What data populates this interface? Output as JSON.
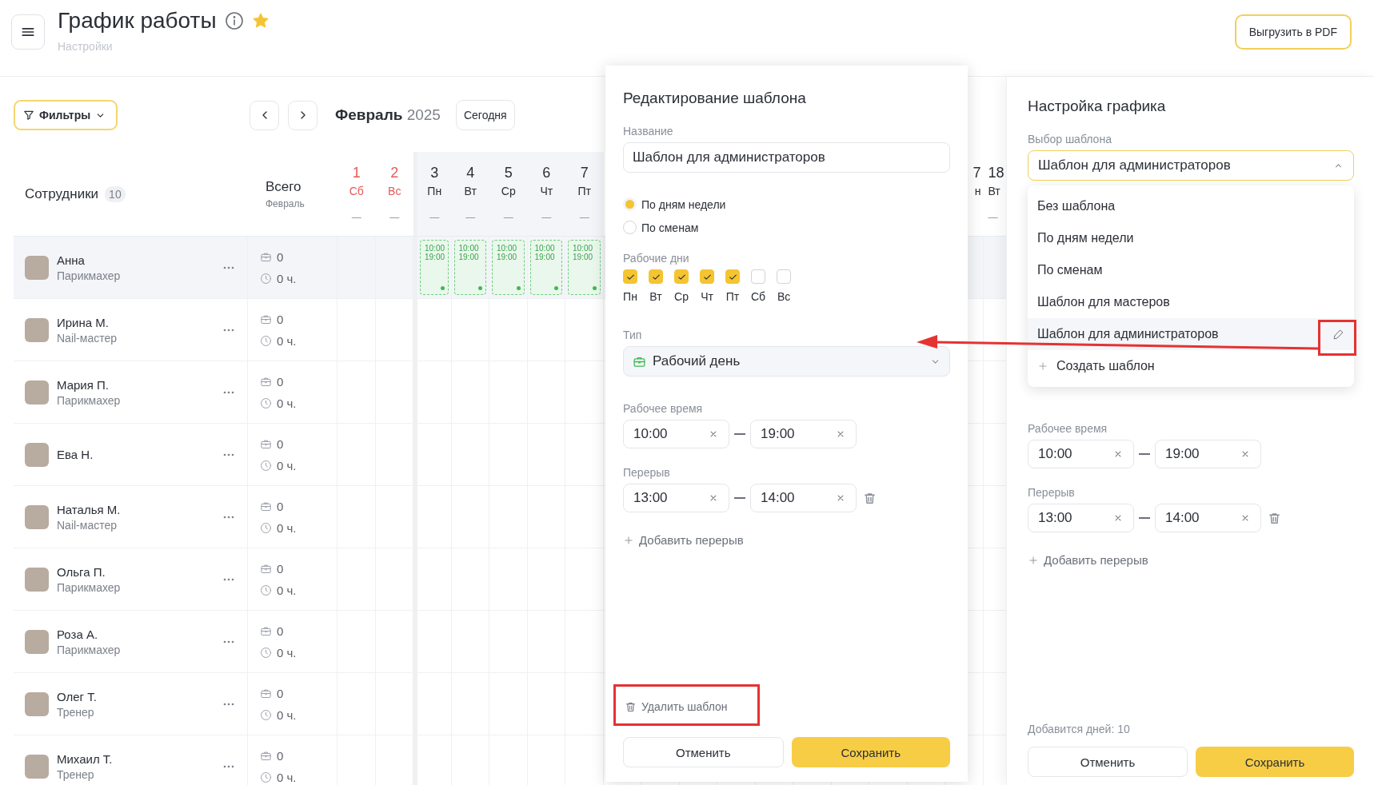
{
  "header": {
    "title": "График работы",
    "subtitle": "Настройки",
    "favorite": true,
    "export_button": "Выгрузить в PDF"
  },
  "toolbar": {
    "filters": "Фильтры",
    "month": "Февраль",
    "year": "2025",
    "today": "Сегодня"
  },
  "table": {
    "employees_heading": "Сотрудники",
    "employees_count": "10",
    "total_heading": "Всего",
    "total_sub": "Февраль",
    "days": [
      {
        "day": "1",
        "weekday": "Сб",
        "weekend": true,
        "week_start": false,
        "summary": "—"
      },
      {
        "day": "2",
        "weekday": "Вс",
        "weekend": true,
        "week_start": false,
        "summary": "—"
      },
      {
        "day": "3",
        "weekday": "Пн",
        "weekend": false,
        "week_start": true,
        "summary": "—"
      },
      {
        "day": "4",
        "weekday": "Вт",
        "weekend": false,
        "week_start": false,
        "summary": "—"
      },
      {
        "day": "5",
        "weekday": "Ср",
        "weekend": false,
        "week_start": false,
        "summary": "—"
      },
      {
        "day": "6",
        "weekday": "Чт",
        "weekend": false,
        "week_start": false,
        "summary": "—"
      },
      {
        "day": "7",
        "weekday": "Пт",
        "weekend": false,
        "week_start": false,
        "summary": "—"
      }
    ],
    "days_right": [
      {
        "day": "7",
        "weekday": "н"
      },
      {
        "day": "18",
        "weekday": "Вт",
        "summary": "—"
      }
    ],
    "rows": [
      {
        "name": "Анна",
        "role": "Парикмахер",
        "shifts": "0",
        "hours": "0 ч.",
        "selected": true,
        "day_cells": [
          {
            "kind": "empty"
          },
          {
            "kind": "empty"
          },
          {
            "kind": "shift",
            "start": "10:00",
            "end": "19:00"
          },
          {
            "kind": "shift",
            "start": "10:00",
            "end": "19:00"
          },
          {
            "kind": "shift",
            "start": "10:00",
            "end": "19:00"
          },
          {
            "kind": "shift",
            "start": "10:00",
            "end": "19:00"
          },
          {
            "kind": "shift",
            "start": "10:00",
            "end": "19:00"
          }
        ]
      },
      {
        "name": "Ирина М.",
        "role": "Nail-мастер",
        "shifts": "0",
        "hours": "0 ч.",
        "selected": false
      },
      {
        "name": "Мария П.",
        "role": "Парикмахер",
        "shifts": "0",
        "hours": "0 ч.",
        "selected": false
      },
      {
        "name": "Ева Н.",
        "shifts": "0",
        "hours": "0 ч.",
        "selected": false
      },
      {
        "name": "Наталья М.",
        "role": "Nail-мастер",
        "shifts": "0",
        "hours": "0 ч.",
        "selected": false
      },
      {
        "name": "Ольга П.",
        "role": "Парикмахер",
        "shifts": "0",
        "hours": "0 ч.",
        "selected": false
      },
      {
        "name": "Роза А.",
        "role": "Парикмахер",
        "shifts": "0",
        "hours": "0 ч.",
        "selected": false
      },
      {
        "name": "Олег Т.",
        "role": "Тренер",
        "shifts": "0",
        "hours": "0 ч.",
        "selected": false
      },
      {
        "name": "Михаил Т.",
        "role": "Тренер",
        "shifts": "0",
        "hours": "0 ч.",
        "selected": false
      }
    ]
  },
  "template_editor": {
    "title": "Редактирование шаблона",
    "name_label": "Название",
    "name_value": "Шаблон для администраторов",
    "modes": [
      {
        "label": "По дням недели",
        "selected": true
      },
      {
        "label": "По сменам",
        "selected": false
      }
    ],
    "workdays_label": "Рабочие дни",
    "workdays": [
      {
        "label": "Пн",
        "checked": true
      },
      {
        "label": "Вт",
        "checked": true
      },
      {
        "label": "Ср",
        "checked": true
      },
      {
        "label": "Чт",
        "checked": true
      },
      {
        "label": "Пт",
        "checked": true
      },
      {
        "label": "Сб",
        "checked": false
      },
      {
        "label": "Вс",
        "checked": false
      }
    ],
    "type_label": "Тип",
    "type_value": "Рабочий день",
    "work_time_label": "Рабочее время",
    "work_time": {
      "from": "10:00",
      "to": "19:00"
    },
    "break_label": "Перерыв",
    "break_time": {
      "from": "13:00",
      "to": "14:00"
    },
    "add_break": "Добавить перерыв",
    "delete": "Удалить шаблон",
    "cancel": "Отменить",
    "save": "Сохранить"
  },
  "schedule_panel": {
    "title": "Настройка графика",
    "template_label": "Выбор шаблона",
    "template_value": "Шаблон для администраторов",
    "expanded": true,
    "options": [
      {
        "label": "Без шаблона",
        "selected": false
      },
      {
        "label": "По дням недели",
        "selected": false
      },
      {
        "label": "По сменам",
        "selected": false
      },
      {
        "label": "Шаблон для мастеров",
        "selected": false
      },
      {
        "label": "Шаблон для администраторов",
        "selected": true
      }
    ],
    "create_option": "Создать шаблон",
    "work_time_label": "Рабочее время",
    "work_time": {
      "from": "10:00",
      "to": "19:00"
    },
    "break_label": "Перерыв",
    "break_time": {
      "from": "13:00",
      "to": "14:00"
    },
    "add_break": "Добавить перерыв",
    "days_added": "Добавится дней: 10",
    "cancel": "Отменить",
    "save": "Сохранить"
  }
}
